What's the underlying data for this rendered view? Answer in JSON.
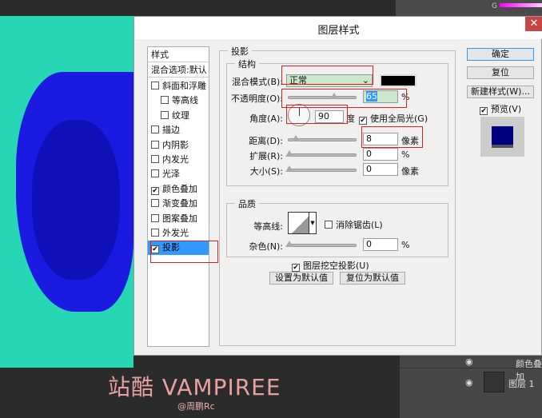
{
  "dialog": {
    "title": "图层样式",
    "close": "✕"
  },
  "styles": {
    "header": "样式",
    "blend": "混合选项:默认",
    "items": [
      {
        "label": "斜面和浮雕",
        "checked": false
      },
      {
        "label": "等高线",
        "checked": false,
        "indent": true
      },
      {
        "label": "纹理",
        "checked": false,
        "indent": true
      },
      {
        "label": "描边",
        "checked": false
      },
      {
        "label": "内阴影",
        "checked": false
      },
      {
        "label": "内发光",
        "checked": false
      },
      {
        "label": "光泽",
        "checked": false
      },
      {
        "label": "颜色叠加",
        "checked": true
      },
      {
        "label": "渐变叠加",
        "checked": false
      },
      {
        "label": "图案叠加",
        "checked": false
      },
      {
        "label": "外发光",
        "checked": false
      },
      {
        "label": "投影",
        "checked": true,
        "selected": true
      }
    ]
  },
  "shadow": {
    "section": "投影",
    "structure": "结构",
    "blend_label": "混合模式(B):",
    "blend_value": "正常",
    "color": "#000000",
    "opacity_label": "不透明度(O):",
    "opacity": "65",
    "opacity_unit": "%",
    "angle_label": "角度(A):",
    "angle": "90",
    "angle_unit": "度",
    "global_light": "使用全局光(G)",
    "distance_label": "距离(D):",
    "distance": "8",
    "distance_unit": "像素",
    "spread_label": "扩展(R):",
    "spread": "0",
    "spread_unit": "%",
    "size_label": "大小(S):",
    "size": "0",
    "size_unit": "像素",
    "quality": "品质",
    "contour_label": "等高线:",
    "antialias": "消除锯齿(L)",
    "noise_label": "杂色(N):",
    "noise": "0",
    "noise_unit": "%",
    "knockout": "图层挖空投影(U)",
    "set_default": "设置为默认值",
    "reset_default": "复位为默认值"
  },
  "buttons": {
    "ok": "确定",
    "reset": "复位",
    "new_style": "新建样式(W)...",
    "preview": "预览(V)"
  },
  "layers": {
    "color_overlay": "颜色叠加",
    "layer1": "图层 1"
  },
  "toppanel": {
    "channel": "G"
  },
  "watermark": {
    "title": "站酷 VAMPIREE",
    "credit": "@周鹏Rc"
  }
}
